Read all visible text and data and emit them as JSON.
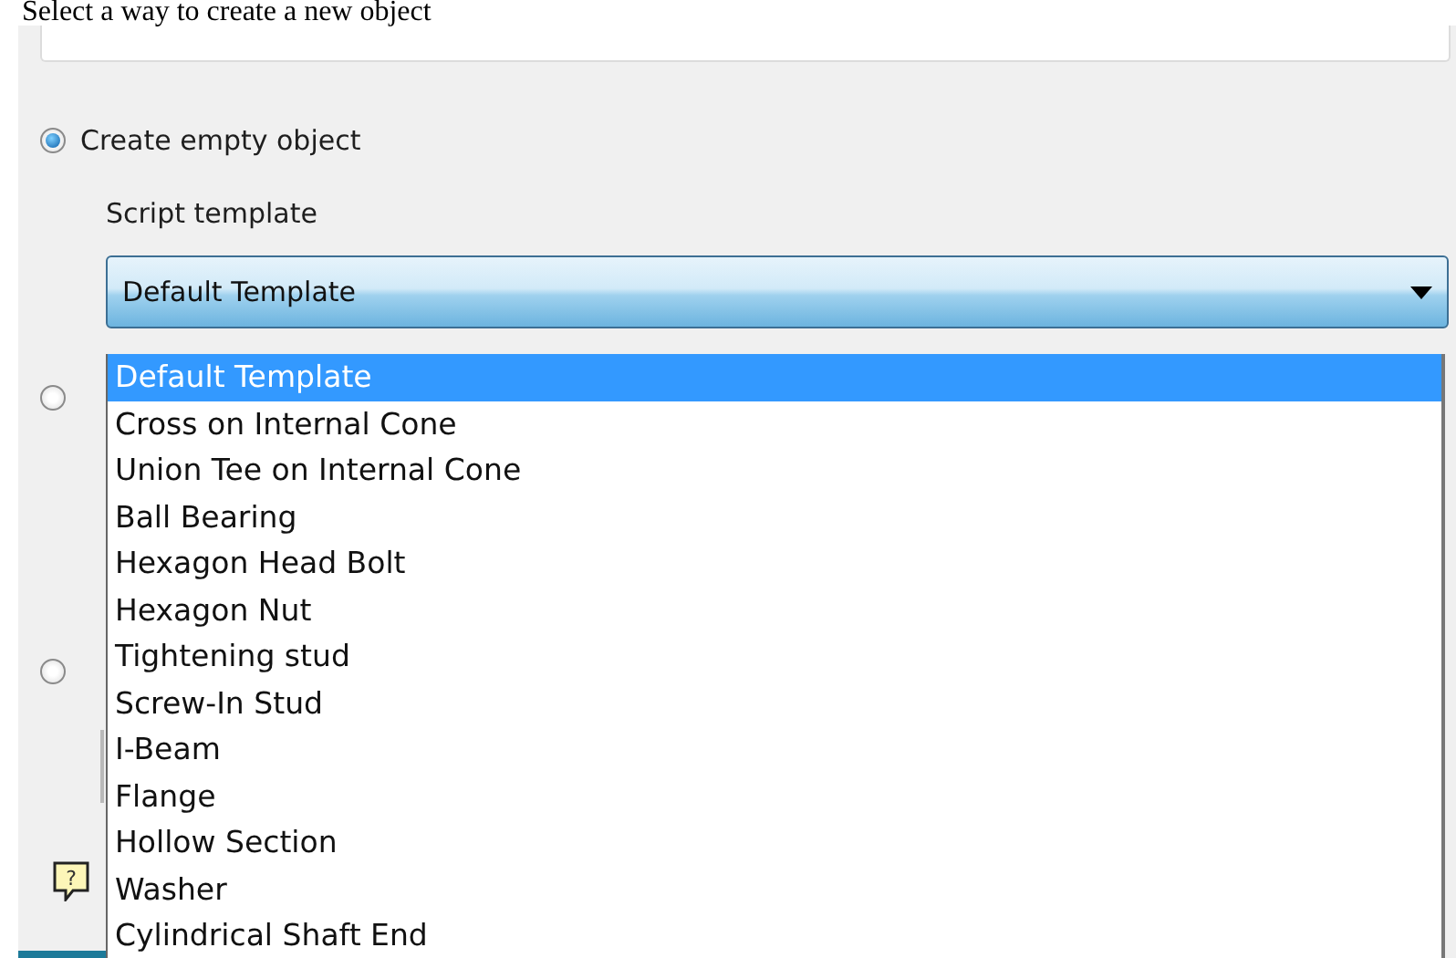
{
  "header": {
    "title": "Select a way to create a new object"
  },
  "options": [
    {
      "label": "Create empty object",
      "selected": true
    },
    {
      "selected": false
    },
    {
      "selected": false
    }
  ],
  "help": {
    "glyph": "?"
  },
  "template": {
    "label": "Script template",
    "value": "Default Template"
  },
  "dropdown": {
    "items": [
      {
        "label": "Default Template",
        "selected": true
      },
      {
        "label": "Cross on Internal Cone",
        "selected": false
      },
      {
        "label": "Union Tee on Internal Cone",
        "selected": false
      },
      {
        "label": "Ball Bearing",
        "selected": false
      },
      {
        "label": "Hexagon Head Bolt",
        "selected": false
      },
      {
        "label": "Hexagon Nut",
        "selected": false
      },
      {
        "label": "Tightening stud",
        "selected": false
      },
      {
        "label": "Screw-In Stud",
        "selected": false
      },
      {
        "label": "I-Beam",
        "selected": false
      },
      {
        "label": "Flange",
        "selected": false
      },
      {
        "label": "Hollow Section",
        "selected": false
      },
      {
        "label": "Washer",
        "selected": false
      },
      {
        "label": "Cylindrical Shaft End",
        "selected": false
      }
    ]
  }
}
